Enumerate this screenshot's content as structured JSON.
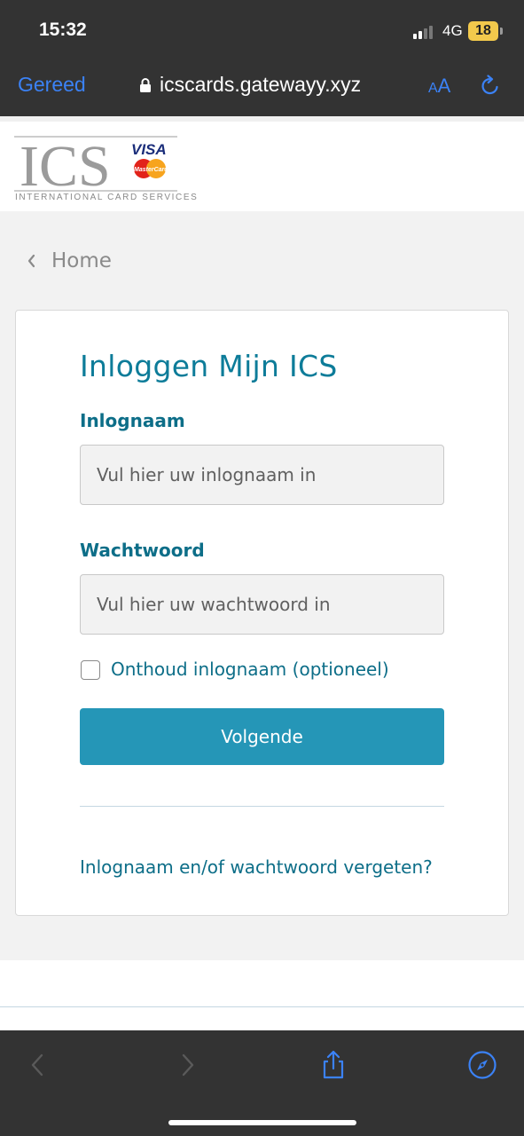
{
  "status_bar": {
    "time": "15:32",
    "network": "4G",
    "battery": "18"
  },
  "browser": {
    "done_label": "Gereed",
    "url": "icscards.gatewayy.xyz",
    "text_size_small": "A",
    "text_size_big": "A"
  },
  "logo": {
    "subtitle": "INTERNATIONAL CARD SERVICES"
  },
  "breadcrumb": {
    "label": "Home"
  },
  "login": {
    "title": "Inloggen Mijn ICS",
    "username_label": "Inlognaam",
    "username_placeholder": "Vul hier uw inlognaam in",
    "password_label": "Wachtwoord",
    "password_placeholder": "Vul hier uw wachtwoord in",
    "remember_label": "Onthoud inlognaam (optioneel)",
    "remember_checked": false,
    "next_button": "Volgende",
    "forgot_link": "Inlognaam en/of wachtwoord vergeten?"
  },
  "colors": {
    "accent": "#2596b7",
    "heading": "#0d7c99",
    "browser_blue": "#3b82f6",
    "chrome_bg": "#333333"
  },
  "icons": {
    "lock": "lock-icon",
    "reload": "reload-icon",
    "back": "chevron-left-icon",
    "forward": "chevron-right-icon",
    "share": "share-icon",
    "compass": "compass-icon"
  }
}
